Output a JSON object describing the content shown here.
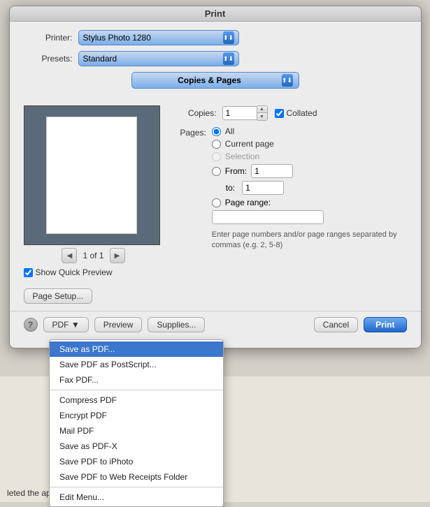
{
  "window": {
    "title": "Print"
  },
  "dialog": {
    "title": "Print",
    "printer_label": "Printer:",
    "presets_label": "Presets:",
    "copies_pages_label": "Copies & Pages",
    "printer_value": "Stylus Photo 1280",
    "presets_value": "Standard",
    "copies_label": "Copies:",
    "copies_value": "1",
    "collated_label": "Collated",
    "pages_label": "Pages:",
    "radio_all": "All",
    "radio_current": "Current page",
    "radio_selection": "Selection",
    "radio_from": "From:",
    "from_value": "1",
    "to_label": "to:",
    "to_value": "1",
    "radio_range": "Page range:",
    "hint": "Enter page numbers and/or page ranges separated by commas (e.g. 2, 5-8)",
    "page_info": "1 of 1",
    "show_quick_preview": "Show Quick Preview",
    "page_setup_btn": "Page Setup...",
    "help_btn": "?",
    "pdf_btn": "PDF ▼",
    "preview_btn": "Preview",
    "supplies_btn": "Supplies...",
    "cancel_btn": "Cancel",
    "print_btn": "Print"
  },
  "pdf_menu": {
    "items": [
      {
        "label": "Save as PDF...",
        "active": true
      },
      {
        "label": "Save PDF as PostScript...",
        "active": false
      },
      {
        "label": "Fax PDF...",
        "active": false
      },
      {
        "label": "Compress PDF",
        "active": false
      },
      {
        "label": "Encrypt PDF",
        "active": false
      },
      {
        "label": "Mail PDF",
        "active": false
      },
      {
        "label": "Save as PDF-X",
        "active": false
      },
      {
        "label": "Save PDF to iPhoto",
        "active": false
      },
      {
        "label": "Save PDF to Web Receipts Folder",
        "active": false
      },
      {
        "label": "Edit Menu...",
        "active": false
      }
    ]
  },
  "bg_text": "leted the application. The deadline is tonight at midn"
}
